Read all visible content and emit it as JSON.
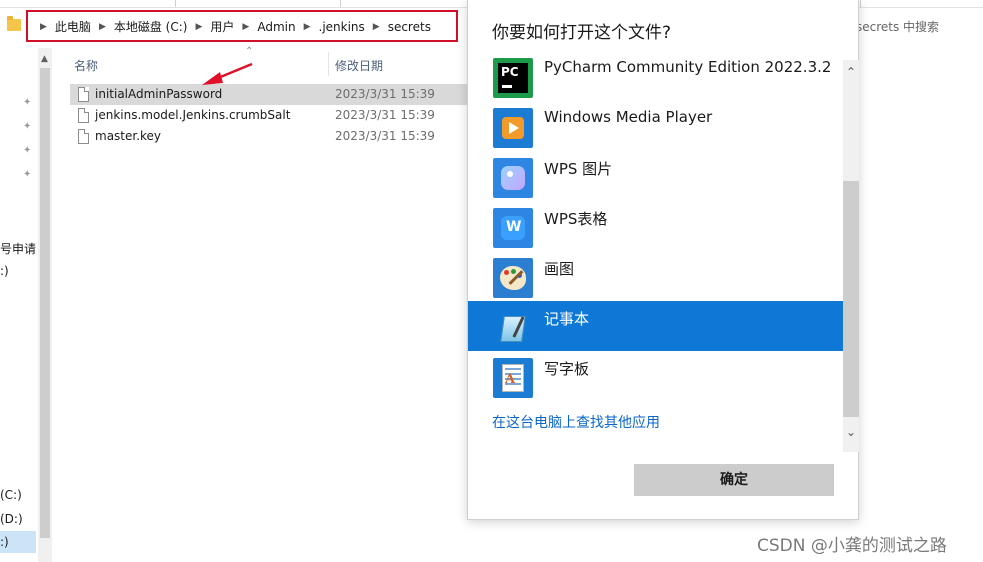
{
  "explorer": {
    "breadcrumb": [
      "此电脑",
      "本地磁盘 (C:)",
      "用户",
      "Admin",
      ".jenkins",
      "secrets"
    ],
    "search_placeholder": "secrets 中搜索",
    "nav_items": [
      "号申请",
      ":)",
      "(C:)",
      "(D:)",
      ":)"
    ],
    "columns": {
      "name": "名称",
      "date": "修改日期"
    },
    "files": [
      {
        "name": "initialAdminPassword",
        "date": "2023/3/31 15:39"
      },
      {
        "name": "jenkins.model.Jenkins.crumbSalt",
        "date": "2023/3/31 15:39"
      },
      {
        "name": "master.key",
        "date": "2023/3/31 15:39"
      }
    ]
  },
  "dialog": {
    "title": "你要如何打开这个文件?",
    "apps": [
      {
        "label": "PyCharm Community Edition 2022.3.2",
        "icon": "pycharm-icon"
      },
      {
        "label": "Windows Media Player",
        "icon": "media-player-icon"
      },
      {
        "label": "WPS 图片",
        "icon": "wps-picture-icon"
      },
      {
        "label": "WPS表格",
        "icon": "wps-spreadsheet-icon"
      },
      {
        "label": "画图",
        "icon": "paint-icon"
      },
      {
        "label": "记事本",
        "icon": "notepad-icon",
        "selected": true
      },
      {
        "label": "写字板",
        "icon": "wordpad-icon"
      }
    ],
    "more_apps_link": "在这台电脑上查找其他应用",
    "ok_button": "确定",
    "icons": {
      "pycharm_text": "PC",
      "wps_sheet_text": "W",
      "wordpad_text": "A"
    }
  },
  "colors": {
    "accent": "#0f78d7",
    "highlight_box": "#d0102a",
    "link": "#0c67c8"
  },
  "watermark": "CSDN @小龚的测试之路"
}
